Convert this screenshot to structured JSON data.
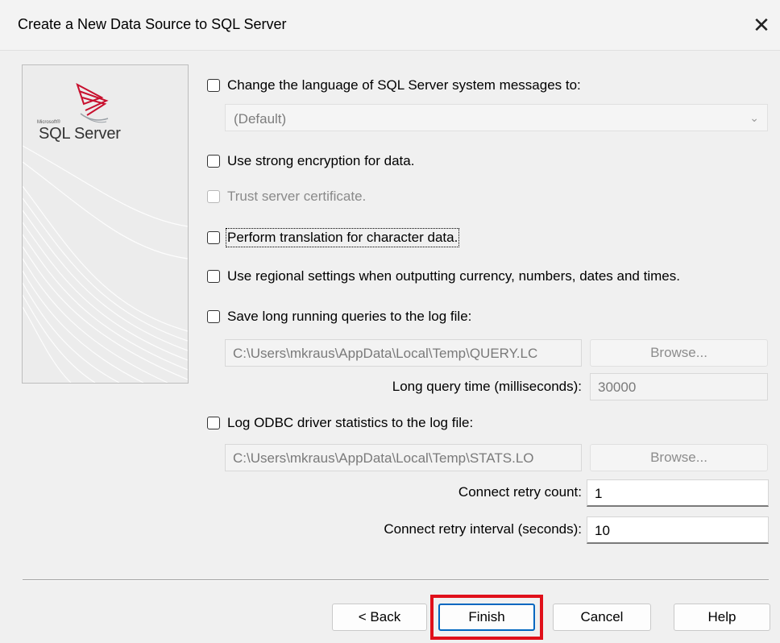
{
  "window": {
    "title": "Create a New Data Source to SQL Server",
    "close_glyph": "✕"
  },
  "brand": {
    "small_text": "Microsoft®",
    "large_text": "SQL Server",
    "logo_icon": "sql-server-logo-icon"
  },
  "options": {
    "change_language": {
      "label": "Change the language of SQL Server system messages to:",
      "checked": false
    },
    "language_dropdown": {
      "value": "(Default)",
      "icon": "chevron-down-icon"
    },
    "strong_encryption": {
      "label": "Use strong encryption for data.",
      "checked": false
    },
    "trust_cert": {
      "label": "Trust server certificate.",
      "checked": false,
      "disabled": true
    },
    "translation": {
      "label": "Perform translation for character data.",
      "checked": false
    },
    "regional": {
      "label": "Use regional settings when outputting currency, numbers, dates and times.",
      "checked": false
    },
    "save_queries": {
      "label": "Save long running queries to the log file:",
      "checked": false
    },
    "query_log_path": "C:\\Users\\mkraus\\AppData\\Local\\Temp\\QUERY.LC",
    "query_browse": "Browse...",
    "long_query_label": "Long query time (milliseconds):",
    "long_query_value": "30000",
    "log_stats": {
      "label": "Log ODBC driver statistics to the log file:",
      "checked": false
    },
    "stats_log_path": "C:\\Users\\mkraus\\AppData\\Local\\Temp\\STATS.LO",
    "stats_browse": "Browse...",
    "retry_count_label": "Connect retry count:",
    "retry_count_value": "1",
    "retry_interval_label": "Connect retry interval (seconds):",
    "retry_interval_value": "10"
  },
  "footer": {
    "back": "< Back",
    "finish": "Finish",
    "cancel": "Cancel",
    "help": "Help"
  },
  "colors": {
    "highlight": "#e0101a",
    "logo_red": "#c8102e",
    "default_button": "#0067c0"
  }
}
